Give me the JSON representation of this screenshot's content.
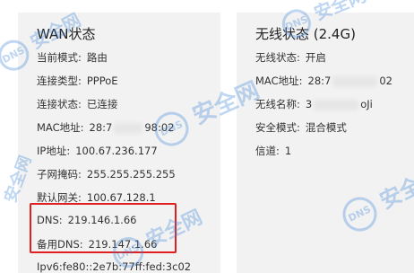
{
  "wan": {
    "title": "WAN状态",
    "rows": [
      {
        "label": "当前模式:",
        "value": "路由"
      },
      {
        "label": "连接类型:",
        "value": "PPPoE"
      },
      {
        "label": "连接状态:",
        "value": "已连接"
      },
      {
        "label": "MAC地址:",
        "value_prefix": "28:7",
        "value_suffix": "98:02"
      },
      {
        "label": "IP地址:",
        "value": "100.67.236.177"
      },
      {
        "label": "子网掩码:",
        "value": "255.255.255.255"
      },
      {
        "label": "默认网关:",
        "value": "100.67.128.1"
      },
      {
        "label": "DNS:",
        "value": "219.146.1.66"
      },
      {
        "label": "备用DNS:",
        "value": "219.147.1.66"
      }
    ],
    "partial_row": "Ipv6:fe80::2e7b:77ff:fed:3c02"
  },
  "wifi": {
    "title": "无线状态 (2.4G)",
    "rows": [
      {
        "label": "无线状态:",
        "value": "开启"
      },
      {
        "label": "MAC地址:",
        "value_prefix": "28:7",
        "value_suffix": "02"
      },
      {
        "label": "无线名称:",
        "value_prefix": "3",
        "value_suffix": "oJi"
      },
      {
        "label": "安全模式:",
        "value": "混合模式"
      },
      {
        "label": "信道:",
        "value": "1"
      }
    ]
  },
  "watermark": {
    "text": "安全网",
    "badge": "DNS",
    "color": "#3a86d8"
  },
  "highlight_color": "#e02020"
}
